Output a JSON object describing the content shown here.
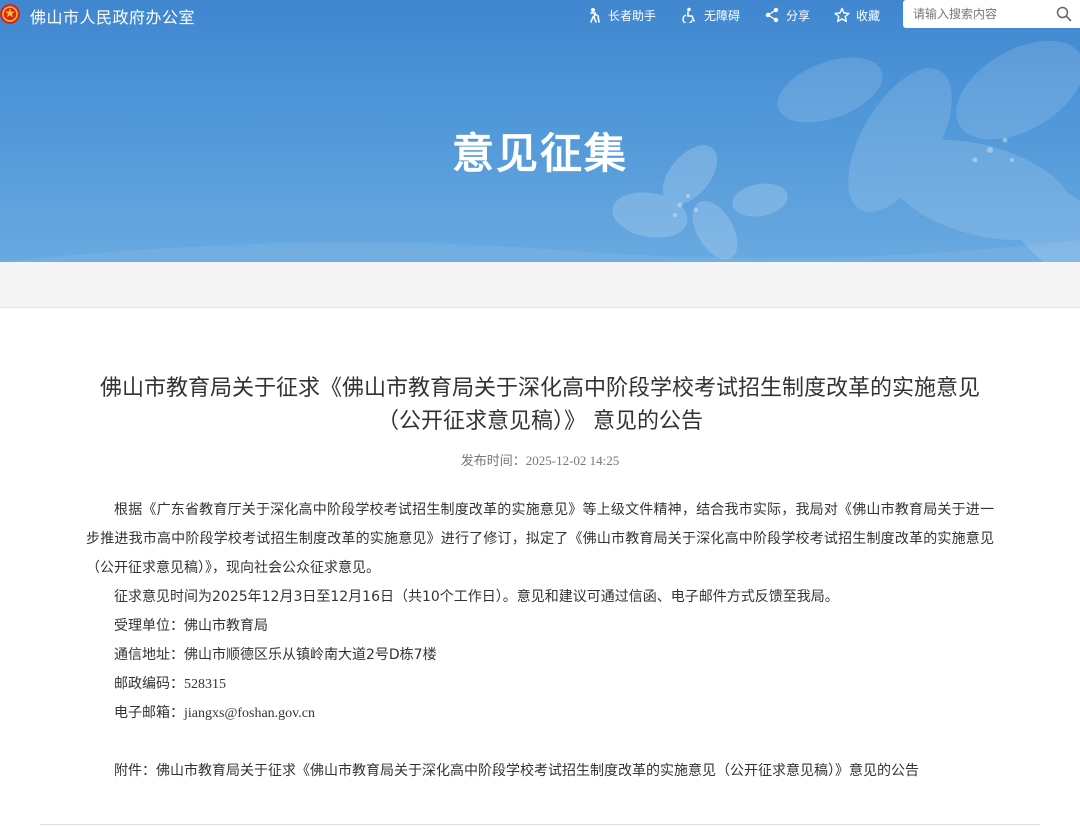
{
  "header": {
    "site_name": "佛山市人民政府办公室",
    "tools": {
      "elder": "长者助手",
      "accessibility": "无障碍",
      "share": "分享",
      "favorite": "收藏"
    },
    "search": {
      "placeholder": "请输入搜索内容",
      "value": ""
    }
  },
  "banner": {
    "title": "意见征集"
  },
  "article": {
    "title_line1": "佛山市教育局关于征求《佛山市教育局关于深化高中阶段学校考试招生制度改革的实施意见",
    "title_line2": "（公开征求意见稿）》 意见的公告",
    "publish_label": "发布时间：",
    "publish_time": "2025-12-02 14:25",
    "paragraph1": "根据《广东省教育厅关于深化高中阶段学校考试招生制度改革的实施意见》等上级文件精神，结合我市实际，我局对《佛山市教育局关于进一步推进我市高中阶段学校考试招生制度改革的实施意见》进行了修订，拟定了《佛山市教育局关于深化高中阶段学校考试招生制度改革的实施意见（公开征求意见稿）》，现向社会公众征求意见。",
    "paragraph2": "征求意见时间为2025年12月3日至12月16日（共10个工作日）。意见和建议可通过信函、电子邮件方式反馈至我局。",
    "contact": {
      "unit_label": "受理单位：",
      "unit_value": "佛山市教育局",
      "address_label": "通信地址：",
      "address_value": "佛山市顺德区乐从镇岭南大道2号D栋7楼",
      "postcode_label": "邮政编码：",
      "postcode_value": "528315",
      "email_label": "电子邮箱：",
      "email_value": "jiangxs@foshan.gov.cn"
    },
    "attachment": "附件：佛山市教育局关于征求《佛山市教育局关于深化高中阶段学校考试招生制度改革的实施意见（公开征求意见稿）》意见的公告"
  },
  "colors": {
    "banner_blue": "#4e96d8",
    "emblem_red": "#d7261c",
    "emblem_gold": "#f3c23a"
  },
  "icons": [
    "emblem-icon",
    "elder-helper-icon",
    "accessibility-icon",
    "share-icon",
    "star-icon",
    "search-icon"
  ]
}
